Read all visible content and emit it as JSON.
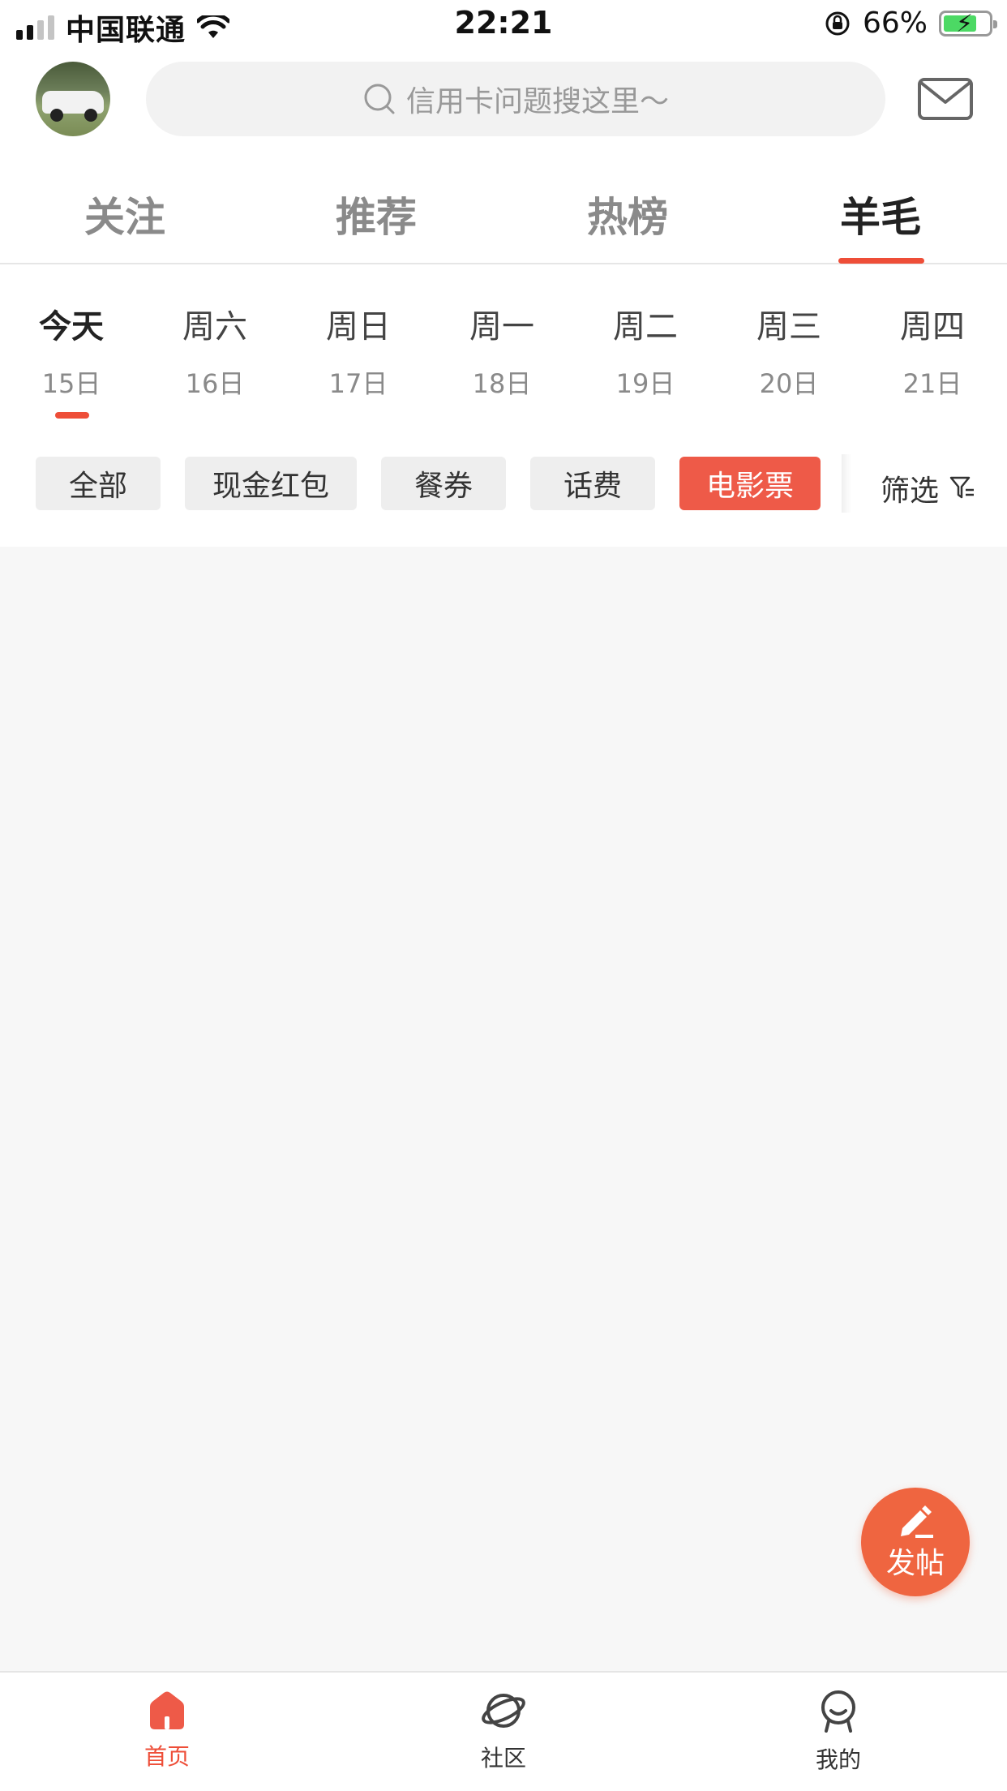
{
  "status_bar": {
    "carrier": "中国联通",
    "time": "22:21",
    "battery": "66%",
    "battery_level": 0.66,
    "icons": [
      "signal-icon",
      "wifi-icon",
      "orientation-lock-icon",
      "battery-icon"
    ]
  },
  "header": {
    "search_placeholder": "信用卡问题搜这里～",
    "icons": [
      "avatar",
      "search-icon",
      "mail-icon"
    ]
  },
  "top_tabs": [
    {
      "label": "关注",
      "active": false
    },
    {
      "label": "推荐",
      "active": false
    },
    {
      "label": "热榜",
      "active": false
    },
    {
      "label": "羊毛",
      "active": true
    }
  ],
  "days": [
    {
      "name": "今天",
      "date": "15日",
      "active": true
    },
    {
      "name": "周六",
      "date": "16日",
      "active": false
    },
    {
      "name": "周日",
      "date": "17日",
      "active": false
    },
    {
      "name": "周一",
      "date": "18日",
      "active": false
    },
    {
      "name": "周二",
      "date": "19日",
      "active": false
    },
    {
      "name": "周三",
      "date": "20日",
      "active": false
    },
    {
      "name": "周四",
      "date": "21日",
      "active": false
    }
  ],
  "categories": [
    {
      "label": "全部",
      "active": false
    },
    {
      "label": "现金红包",
      "active": false
    },
    {
      "label": "餐券",
      "active": false
    },
    {
      "label": "话费",
      "active": false
    },
    {
      "label": "电影票",
      "active": true
    }
  ],
  "filter_label": "筛选",
  "fab_label": "发帖",
  "bottom_nav": [
    {
      "label": "首页",
      "icon": "home-icon",
      "active": true
    },
    {
      "label": "社区",
      "icon": "planet-icon",
      "active": false
    },
    {
      "label": "我的",
      "icon": "profile-icon",
      "active": false
    }
  ],
  "colors": {
    "accent": "#ee4e38",
    "chip_active": "#ee5a48",
    "fab": "#ef6540",
    "background": "#f7f7f7"
  }
}
